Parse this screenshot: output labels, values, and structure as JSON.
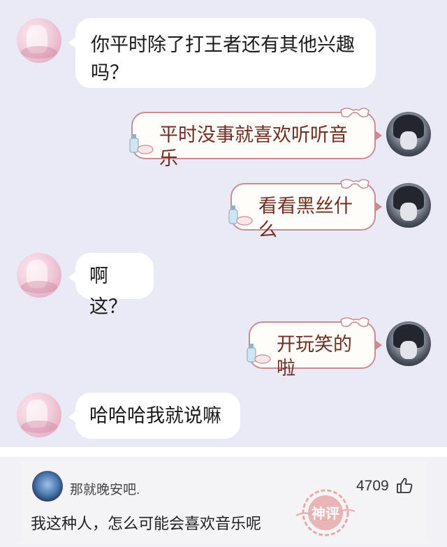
{
  "chat": {
    "messages": [
      {
        "side": "left",
        "text_line1": "你平时除了打王者还有其他兴趣",
        "text_line2": "吗？"
      },
      {
        "side": "right",
        "text": "平时没事就喜欢听听音乐"
      },
      {
        "side": "right",
        "text": "看看黑丝什么"
      },
      {
        "side": "left",
        "text": "啊这？"
      },
      {
        "side": "right",
        "text": "开玩笑的啦"
      },
      {
        "side": "left",
        "text": "哈哈哈我就说嘛"
      }
    ]
  },
  "comment": {
    "username": "那就晚安吧.",
    "likes": "4709",
    "text": "我这种人，怎么可能会喜欢音乐呢",
    "stamp_text": "神评"
  },
  "colors": {
    "chat_bg": "#e9eaf5",
    "deco_border": "#c98c92",
    "deco_text": "#6e2f24",
    "stamp": "#e07a7a"
  }
}
